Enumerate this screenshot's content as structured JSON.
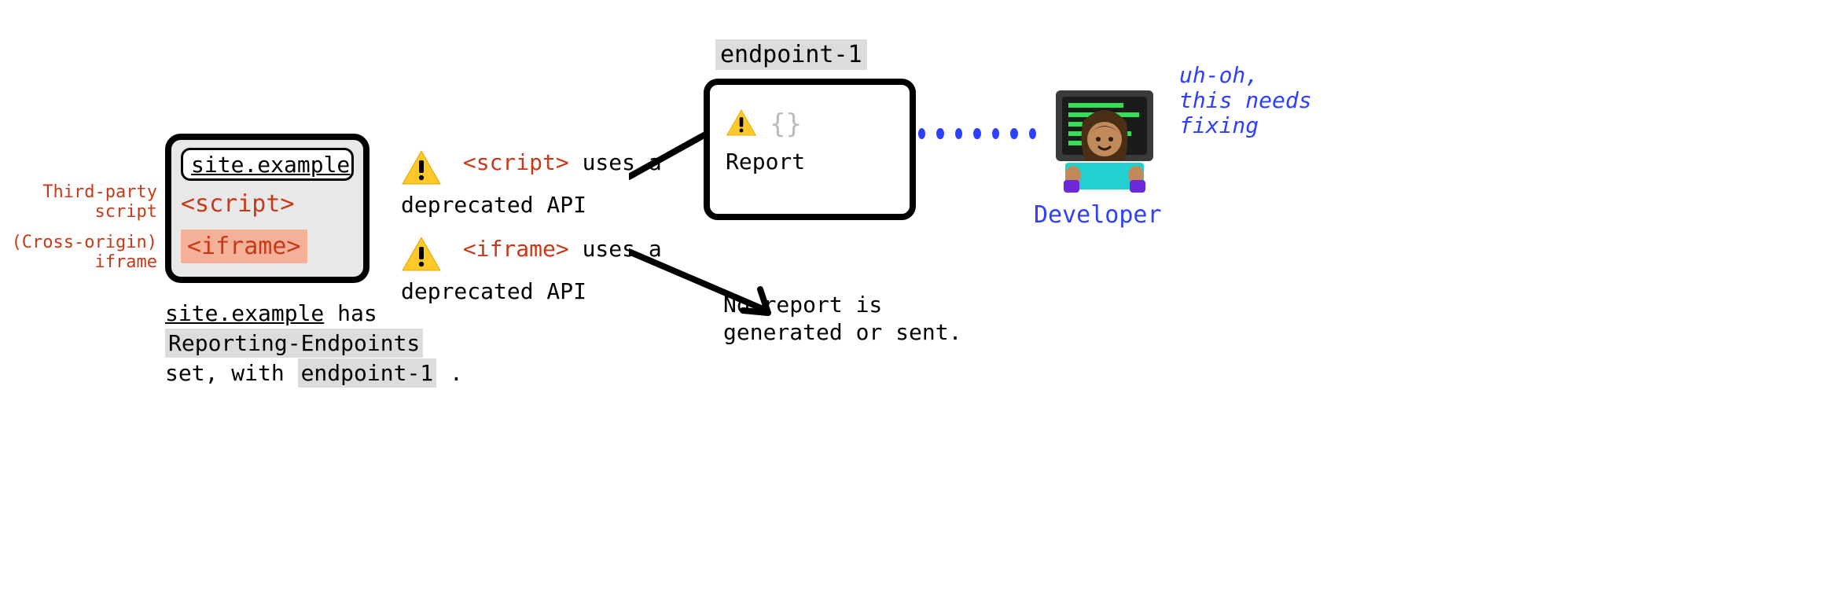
{
  "browser": {
    "url": "site.example",
    "script_tag": "<script>",
    "iframe_tag": "<iframe>"
  },
  "left_annotations": {
    "script": "Third-party\nscript",
    "iframe": "(Cross-origin)\niframe"
  },
  "caption": {
    "url": "site.example",
    "has": " has ",
    "header": "Reporting-Endpoints",
    "set_with": "set, with ",
    "endpoint": "endpoint-1",
    "tail": " ."
  },
  "deprecations": {
    "script_tag": "<script>",
    "script_text": " uses a deprecated API",
    "iframe_tag": "<iframe>",
    "iframe_text": " uses a deprecated API"
  },
  "endpoint": {
    "label": "endpoint-1",
    "braces": "{}",
    "report": "Report"
  },
  "no_report": "No report is generated or sent.",
  "developer": {
    "label": "Developer",
    "thought": "uh-oh,\nthis needs fixing"
  }
}
